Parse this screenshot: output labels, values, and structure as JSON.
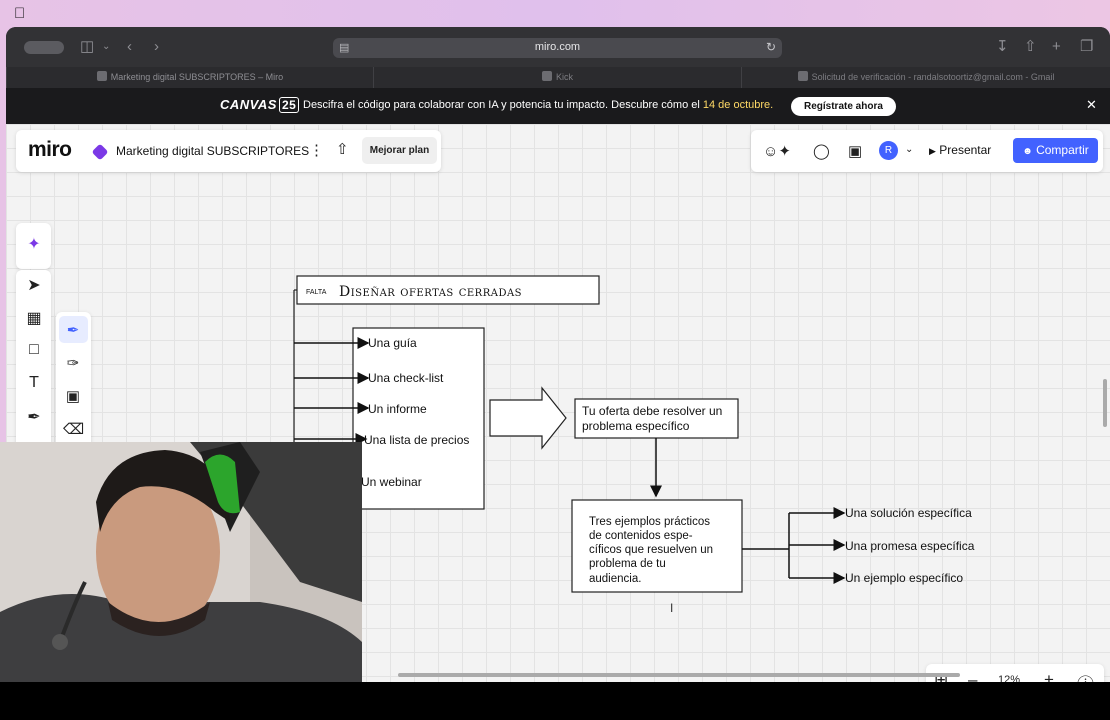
{
  "browser": {
    "url": "miro.com",
    "tabs": [
      {
        "label": "Marketing digital SUBSCRIPTORES – Miro"
      },
      {
        "label": "Kick"
      },
      {
        "label": "Solicitud de verificación - randalsotoortiz@gmail.com - Gmail"
      }
    ]
  },
  "banner": {
    "logo": "CANVAS",
    "logo_badge": "25",
    "text": "Descifra el código para colaborar con IA y potencia tu impacto. Descubre cómo el",
    "date": "14 de octubre.",
    "cta": "Regístrate ahora"
  },
  "miro": {
    "logo": "miro",
    "board_name": "Marketing digital SUBSCRIPTORES",
    "upgrade_label": "Mejorar plan",
    "avatar_initial": "R",
    "present_label": "Presentar",
    "share_label": "Compartir",
    "zoom_label": "12%"
  },
  "diagram": {
    "tag": "FALTA",
    "title": "Diseñar ofertas cerradas",
    "list_items": [
      "Una guía",
      "Una check-list",
      "Un informe",
      "Una lista de precios",
      "Un webinar"
    ],
    "problem_box": [
      "Tu oferta debe resolver un",
      "problema específico"
    ],
    "examples_box": [
      "Tres ejemplos prácticos",
      "de contenidos espe-",
      "cíficos que resuelven un",
      "problema de tu",
      "audiencia."
    ],
    "outcomes": [
      "Una solución específica",
      "Una promesa específica",
      "Un ejemplo específico"
    ]
  },
  "colors": {
    "accent_blue": "#4262ff",
    "board_icon_purple": "#7b39e6",
    "banner_date_yellow": "#ffd966"
  }
}
